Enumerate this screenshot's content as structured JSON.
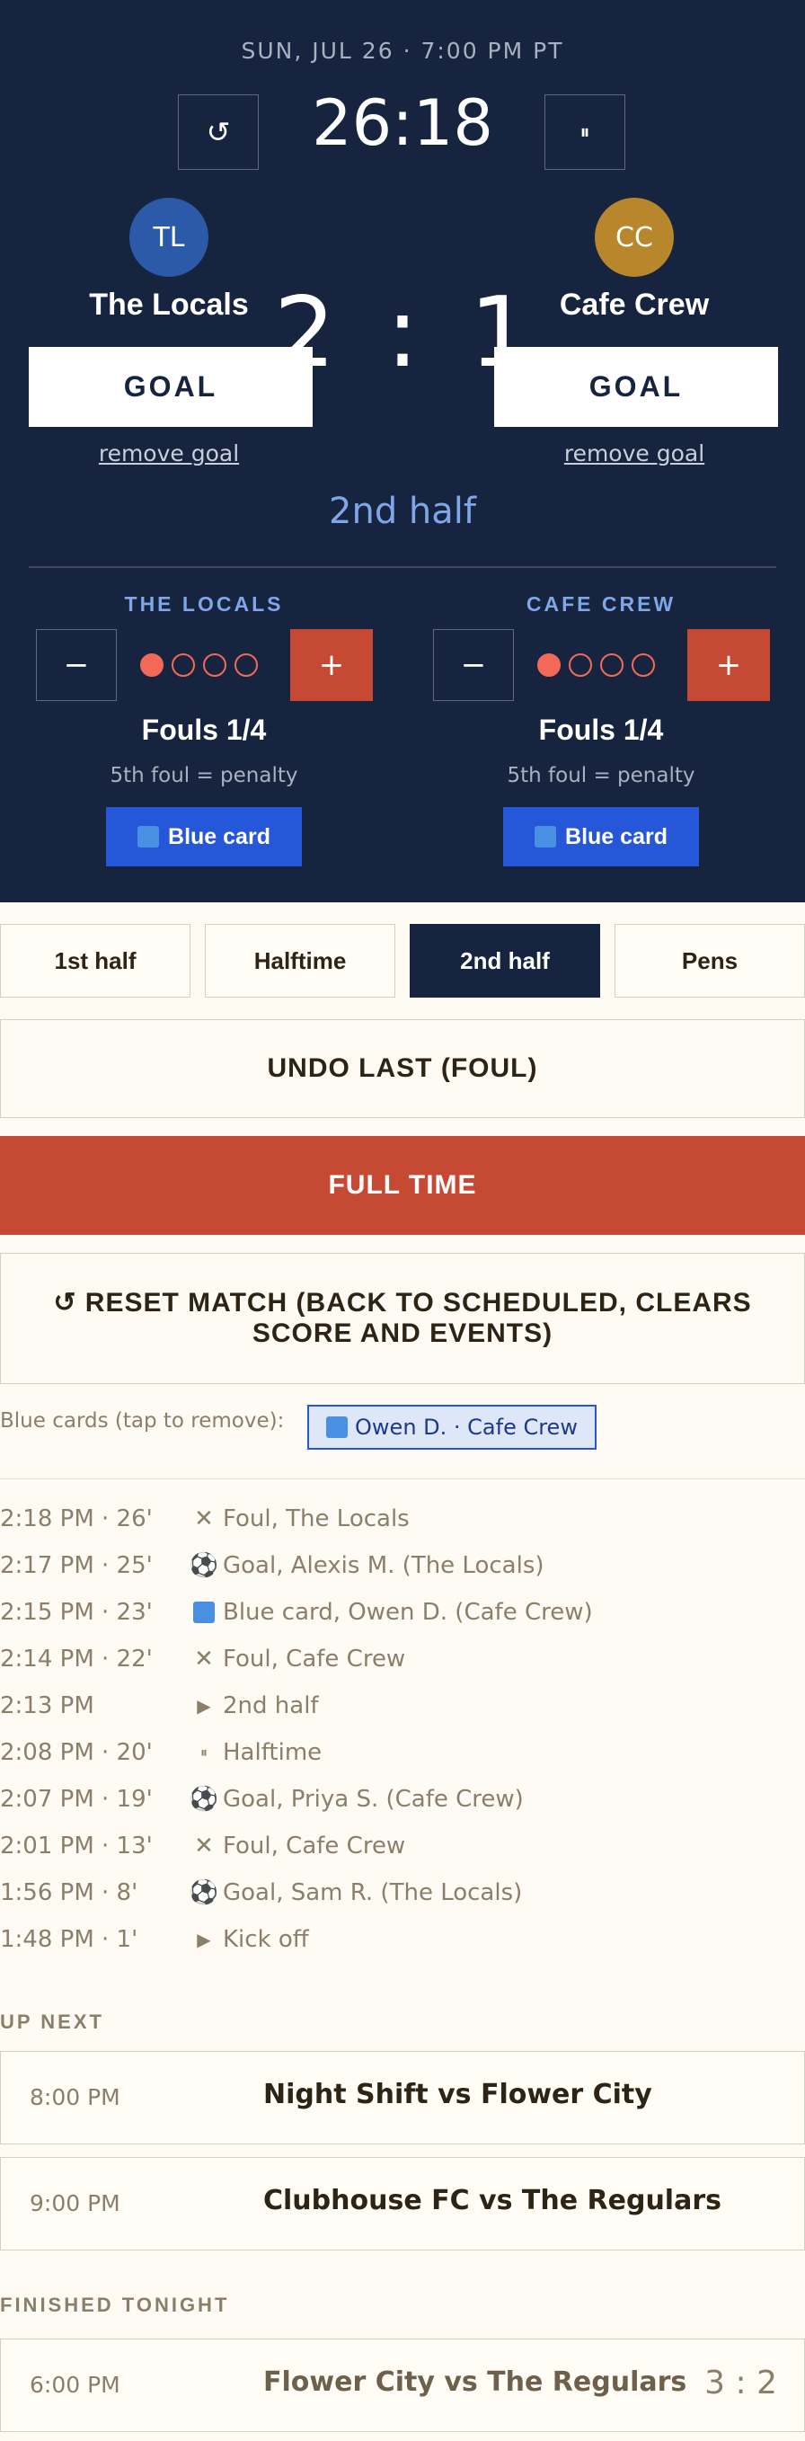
{
  "header": {
    "datetime": "SUN, JUL 26 · 7:00 PM PT",
    "reset_clock_icon": "↺",
    "clock": "26:18",
    "pause_icon": "⏸",
    "period": "2nd half"
  },
  "home": {
    "initials": "TL",
    "name": "The Locals",
    "avatar_color": "#2a5aa8",
    "score": "2",
    "goal_label": "GOAL",
    "remove_goal_label": "remove goal",
    "fouls_head": "THE LOCALS",
    "fouls_label": "Fouls 1/4",
    "fouls_filled": 1,
    "fouls_total": 4,
    "penalty_note": "5th foul = penalty",
    "blue_card_label": "Blue card",
    "minus": "−",
    "plus": "+"
  },
  "away": {
    "initials": "CC",
    "name": "Cafe Crew",
    "avatar_color": "#b8862b",
    "score": "1",
    "goal_label": "GOAL",
    "remove_goal_label": "remove goal",
    "fouls_head": "CAFE CREW",
    "fouls_label": "Fouls 1/4",
    "fouls_filled": 1,
    "fouls_total": 4,
    "penalty_note": "5th foul = penalty",
    "blue_card_label": "Blue card",
    "minus": "−",
    "plus": "+"
  },
  "score_separator": ":",
  "tabs": [
    {
      "label": "1st half",
      "active": false
    },
    {
      "label": "Halftime",
      "active": false
    },
    {
      "label": "2nd half",
      "active": true
    },
    {
      "label": "Pens",
      "active": false
    }
  ],
  "actions": {
    "undo": "UNDO LAST (FOUL)",
    "full_time": "FULL TIME",
    "reset": "↺ RESET MATCH (BACK TO SCHEDULED, CLEARS SCORE AND EVENTS)"
  },
  "blue_cards": {
    "label": "Blue cards (tap to remove):",
    "chips": [
      "Owen D. · Cafe Crew"
    ]
  },
  "events": [
    {
      "time": "2:18 PM · 26'",
      "icon": "foul-icon",
      "glyph": "✕",
      "text": "Foul, The Locals"
    },
    {
      "time": "2:17 PM · 25'",
      "icon": "ball-icon",
      "glyph": "⚽",
      "text": "Goal, Alexis M. (The Locals)"
    },
    {
      "time": "2:15 PM · 23'",
      "icon": "blue-card-icon",
      "glyph": "",
      "text": "Blue card, Owen D. (Cafe Crew)"
    },
    {
      "time": "2:14 PM · 22'",
      "icon": "foul-icon",
      "glyph": "✕",
      "text": "Foul, Cafe Crew"
    },
    {
      "time": "2:13 PM",
      "icon": "play-icon",
      "glyph": "▶",
      "text": "2nd half"
    },
    {
      "time": "2:08 PM · 20'",
      "icon": "pause-icon",
      "glyph": "⏸",
      "text": "Halftime"
    },
    {
      "time": "2:07 PM · 19'",
      "icon": "ball-icon",
      "glyph": "⚽",
      "text": "Goal, Priya S. (Cafe Crew)"
    },
    {
      "time": "2:01 PM · 13'",
      "icon": "foul-icon",
      "glyph": "✕",
      "text": "Foul, Cafe Crew"
    },
    {
      "time": "1:56 PM · 8'",
      "icon": "ball-icon",
      "glyph": "⚽",
      "text": "Goal, Sam R. (The Locals)"
    },
    {
      "time": "1:48 PM · 1'",
      "icon": "play-icon",
      "glyph": "▶",
      "text": "Kick off"
    }
  ],
  "up_next": {
    "heading": "UP NEXT",
    "matches": [
      {
        "time": "8:00 PM",
        "name": "Night Shift vs Flower City"
      },
      {
        "time": "9:00 PM",
        "name": "Clubhouse FC vs The Regulars"
      }
    ]
  },
  "finished": {
    "heading": "FINISHED TONIGHT",
    "matches": [
      {
        "time": "6:00 PM",
        "name": "Flower City vs The Regulars",
        "score": "3 : 2"
      }
    ]
  },
  "colors": {
    "navy": "#16243f",
    "accent_red": "#c64a33",
    "blue_card": "#2557d8",
    "foul_dot": "#f26a57"
  }
}
